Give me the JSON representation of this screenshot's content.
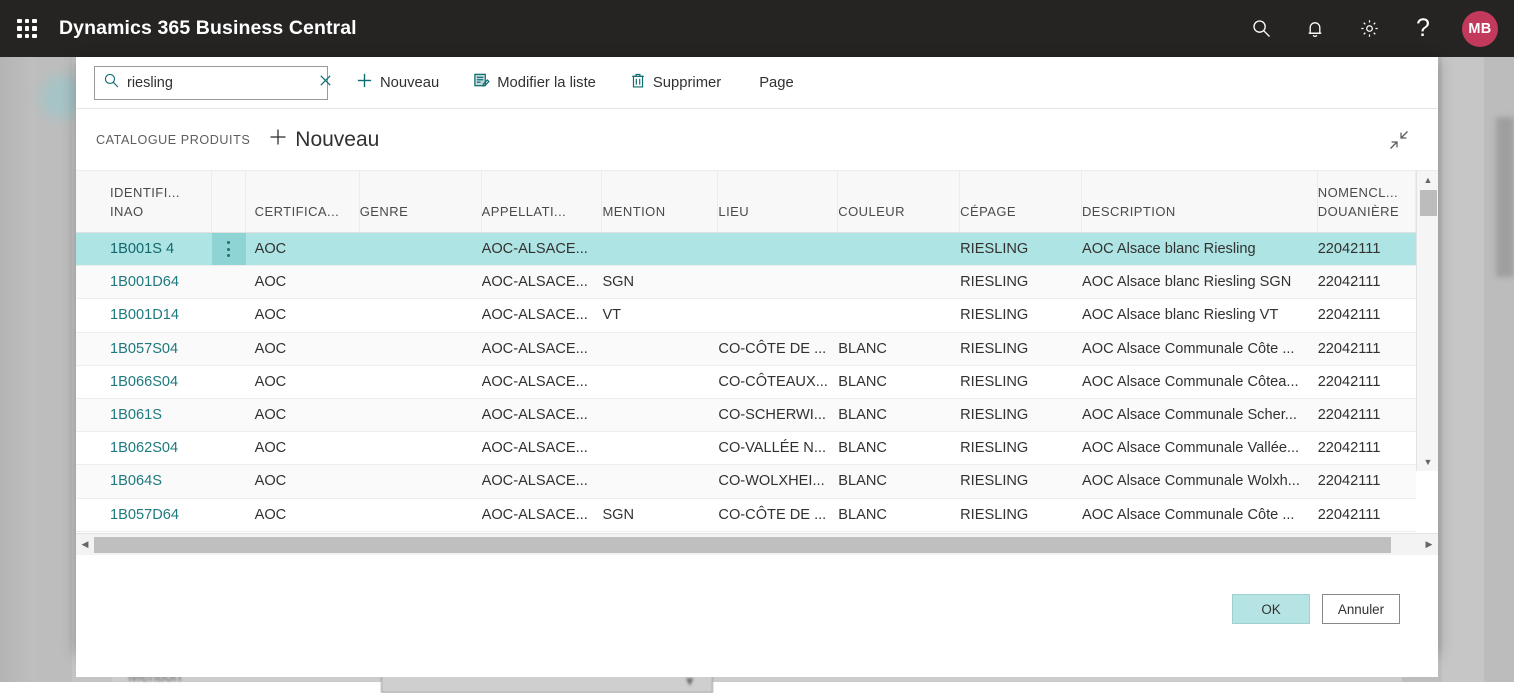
{
  "appbar": {
    "title": "Dynamics 365 Business Central",
    "waffle_icon": "app-launcher-icon",
    "icons": [
      {
        "name": "search-icon",
        "glyph": "search"
      },
      {
        "name": "notifications-bell-icon",
        "glyph": "bell"
      },
      {
        "name": "settings-gear-icon",
        "glyph": "gear"
      },
      {
        "name": "help-question-icon",
        "glyph": "question"
      }
    ],
    "avatar_initials": "MB",
    "avatar_color": "#c2395c"
  },
  "toolbar": {
    "search_value": "riesling",
    "search_placeholder": "",
    "search_icon": "search-icon",
    "clear_icon": "close-icon",
    "new_label": "Nouveau",
    "new_icon": "plus-icon",
    "edit_list_label": "Modifier la liste",
    "edit_list_icon": "edit-list-icon",
    "delete_label": "Supprimer",
    "delete_icon": "trash-icon",
    "page_label": "Page"
  },
  "dialog": {
    "breadcrumb": "CATALOGUE PRODUITS",
    "new_label": "Nouveau",
    "new_icon": "plus-icon",
    "collapse_icon": "collapse-diagonal-icon",
    "ok_label": "OK",
    "cancel_label": "Annuler"
  },
  "grid": {
    "columns": [
      {
        "key": "id",
        "label_line1": "IDENTIFI...",
        "label_line2": "INAO"
      },
      {
        "key": "cert",
        "label_line1": "CERTIFICA...",
        "label_line2": ""
      },
      {
        "key": "genre",
        "label_line1": "GENRE",
        "label_line2": ""
      },
      {
        "key": "app",
        "label_line1": "APPELLATI...",
        "label_line2": ""
      },
      {
        "key": "ment",
        "label_line1": "MENTION",
        "label_line2": ""
      },
      {
        "key": "lieu",
        "label_line1": "LIEU",
        "label_line2": ""
      },
      {
        "key": "coul",
        "label_line1": "COULEUR",
        "label_line2": ""
      },
      {
        "key": "cep",
        "label_line1": "CÉPAGE",
        "label_line2": ""
      },
      {
        "key": "desc",
        "label_line1": "DESCRIPTION",
        "label_line2": ""
      },
      {
        "key": "nom",
        "label_line1": "NOMENCL...",
        "label_line2": "DOUANIÈRE"
      }
    ],
    "selected_row_index": 0,
    "selection_color": "#aee4e4",
    "rows": [
      {
        "id": "1B001S 4",
        "cert": "AOC",
        "genre": "",
        "app": "AOC-ALSACE...",
        "ment": "",
        "lieu": "",
        "coul": "",
        "cep": "RIESLING",
        "desc": "AOC Alsace blanc Riesling",
        "nom": "22042111"
      },
      {
        "id": "1B001D64",
        "cert": "AOC",
        "genre": "",
        "app": "AOC-ALSACE...",
        "ment": "SGN",
        "lieu": "",
        "coul": "",
        "cep": "RIESLING",
        "desc": "AOC Alsace blanc Riesling SGN",
        "nom": "22042111"
      },
      {
        "id": "1B001D14",
        "cert": "AOC",
        "genre": "",
        "app": "AOC-ALSACE...",
        "ment": "VT",
        "lieu": "",
        "coul": "",
        "cep": "RIESLING",
        "desc": "AOC Alsace blanc Riesling VT",
        "nom": "22042111"
      },
      {
        "id": "1B057S04",
        "cert": "AOC",
        "genre": "",
        "app": "AOC-ALSACE...",
        "ment": "",
        "lieu": "CO-CÔTE DE ...",
        "coul": "BLANC",
        "cep": "RIESLING",
        "desc": "AOC Alsace Communale Côte ...",
        "nom": "22042111"
      },
      {
        "id": "1B066S04",
        "cert": "AOC",
        "genre": "",
        "app": "AOC-ALSACE...",
        "ment": "",
        "lieu": "CO-CÔTEAUX...",
        "coul": "BLANC",
        "cep": "RIESLING",
        "desc": "AOC Alsace Communale Côtea...",
        "nom": "22042111"
      },
      {
        "id": "1B061S",
        "cert": "AOC",
        "genre": "",
        "app": "AOC-ALSACE...",
        "ment": "",
        "lieu": "CO-SCHERWI...",
        "coul": "BLANC",
        "cep": "RIESLING",
        "desc": "AOC Alsace Communale Scher...",
        "nom": "22042111"
      },
      {
        "id": "1B062S04",
        "cert": "AOC",
        "genre": "",
        "app": "AOC-ALSACE...",
        "ment": "",
        "lieu": "CO-VALLÉE N...",
        "coul": "BLANC",
        "cep": "RIESLING",
        "desc": "AOC Alsace Communale Vallée...",
        "nom": "22042111"
      },
      {
        "id": "1B064S",
        "cert": "AOC",
        "genre": "",
        "app": "AOC-ALSACE...",
        "ment": "",
        "lieu": "CO-WOLXHEI...",
        "coul": "BLANC",
        "cep": "RIESLING",
        "desc": "AOC Alsace Communale Wolxh...",
        "nom": "22042111"
      },
      {
        "id": "1B057D64",
        "cert": "AOC",
        "genre": "",
        "app": "AOC-ALSACE...",
        "ment": "SGN",
        "lieu": "CO-CÔTE DE ...",
        "coul": "BLANC",
        "cep": "RIESLING",
        "desc": "AOC Alsace Communale Côte ...",
        "nom": "22042111"
      }
    ]
  },
  "background": {
    "mention_label": "Mention"
  }
}
